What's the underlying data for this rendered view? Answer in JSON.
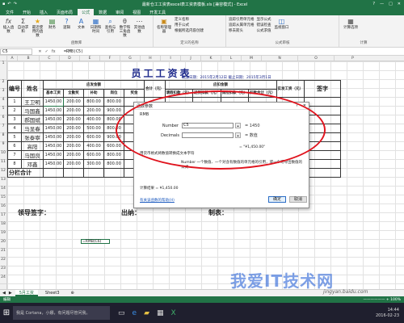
{
  "window": {
    "title": "最新仓工工资表excel表工资表模板.xls [兼容模式] - Excel",
    "qa_icons": [
      "save-icon",
      "undo-icon",
      "redo-icon"
    ],
    "controls": [
      "?",
      "—",
      "□",
      "✕"
    ]
  },
  "ribbon_tabs": [
    "文件",
    "开始",
    "插入",
    "页面布局",
    "公式",
    "数据",
    "审阅",
    "视图",
    "开发工具"
  ],
  "active_tab": "公式",
  "ribbon": {
    "fx_group": [
      {
        "label": "插入函数",
        "icon": "fx-icon"
      },
      {
        "label": "自动求和",
        "icon": "sum-icon"
      },
      {
        "label": "最近使用的函数",
        "icon": "star-icon"
      },
      {
        "label": "财务",
        "icon": "money-icon"
      },
      {
        "label": "逻辑",
        "icon": "question-icon"
      },
      {
        "label": "文本",
        "icon": "text-icon"
      },
      {
        "label": "日期和时间",
        "icon": "calendar-icon"
      },
      {
        "label": "查找与引用",
        "icon": "lookup-icon"
      },
      {
        "label": "数学和三角函数",
        "icon": "theta-icon"
      },
      {
        "label": "其他函数",
        "icon": "more-icon"
      }
    ],
    "fx_group_label": "函数库",
    "names_manager": "名称管理器",
    "names_items": [
      "定义名称",
      "用于公式",
      "根据所选内容创建"
    ],
    "names_label": "定义的名称",
    "audit_items": [
      "追踪引用单元格",
      "追踪从属单元格",
      "移去箭头"
    ],
    "audit_items2": [
      "显示公式",
      "错误检查",
      "公式求值"
    ],
    "watch": "监视窗口",
    "audit_label": "公式审核",
    "calc_options": "计算选项",
    "calc_label": "计算"
  },
  "formula_bar": {
    "name_box": "C5",
    "fx_icons": [
      "✕",
      "✓",
      "fx"
    ],
    "formula": "=RMB(C5)"
  },
  "columns": [
    "A",
    "B",
    "C",
    "D",
    "E",
    "F",
    "G",
    "H",
    "I",
    "J",
    "K",
    "L",
    "M",
    "N",
    "O",
    "P"
  ],
  "rows": [
    "1",
    "2",
    "3",
    "4",
    "5",
    "6",
    "7",
    "8",
    "9",
    "10",
    "11",
    "12",
    "13",
    "14",
    "15",
    "16",
    "17",
    "18",
    "19",
    "20",
    "21",
    "22",
    "23",
    "24",
    "25",
    "26"
  ],
  "sheet": {
    "title": "员工工资表",
    "dateline": "发放日期：2015年2月12日  截止日期：2015年3月1日",
    "headers": {
      "num": "编号",
      "name": "姓名",
      "group_pay": "应发金额",
      "group_deduct": "应扣金额",
      "base": "基本工资",
      "allowance": "全勤奖",
      "bonus": "补助",
      "misc": "岗位",
      "award": "奖金",
      "total": "合计（元）",
      "ded1": "请假扣款（元）",
      "ded2": "迟到扣款（元）",
      "ded3": "保险扣款（元）",
      "ded_total": "扣款合计（元）",
      "actual": "实发工资（元）",
      "sign": "签字"
    },
    "rows": [
      {
        "id": "1",
        "name": "王卫明",
        "base": "1450.00",
        "c": "200.00",
        "d": "800.00",
        "e": "800.00"
      },
      {
        "id": "2",
        "name": "马国鑫",
        "base": "1450.00",
        "c": "200.00",
        "d": "200.00",
        "e": "900.00"
      },
      {
        "id": "3",
        "name": "郝国斌",
        "base": "1450.00",
        "c": "200.00",
        "d": "400.00",
        "e": "800.00"
      },
      {
        "id": "4",
        "name": "马显春",
        "base": "1450.00",
        "c": "200.00",
        "d": "500.00",
        "e": "800.00"
      },
      {
        "id": "5",
        "name": "张泰寧",
        "base": "1450.00",
        "c": "200.00",
        "d": "600.00",
        "e": "900.00"
      },
      {
        "id": "6",
        "name": "高阳",
        "base": "1450.00",
        "c": "200.00",
        "d": "400.00",
        "e": "600.00"
      },
      {
        "id": "7",
        "name": "马国良",
        "base": "1450.00",
        "c": "200.00",
        "d": "600.00",
        "e": "800.00"
      },
      {
        "id": "8",
        "name": "邓鑫",
        "base": "1450.00",
        "c": "200.00",
        "d": "300.00",
        "e": "800.00"
      }
    ],
    "total_label": "分栏合计",
    "sig_leader": "领导签字：",
    "sig_cashier": "出纳：",
    "sig_maker": "制表：",
    "cell_c22": "=RMB(C6)"
  },
  "dialog": {
    "title": "函数参数",
    "controls": [
      "?",
      "✕"
    ],
    "fn_name": "RMB",
    "args": [
      {
        "label": "Number",
        "value": "C5",
        "result": "= 1450"
      },
      {
        "label": "Decimals",
        "value": "",
        "result": "= 数值"
      }
    ],
    "result_preview": "= \"¥1,450.00\"",
    "desc1": "用货币格式将数值转换成文本字符",
    "desc2": "Number  一个数值、一个对含有数值的单元格的引用，或一个可导出数值的公式",
    "calc_result": "计算结果 = ¥1,450.00",
    "help_link": "有关该函数的帮助(H)",
    "ok": "确定",
    "cancel": "取消"
  },
  "sheet_tabs": [
    "5月工资",
    "Sheet3",
    "⊕"
  ],
  "active_sheet": "5月工资",
  "statusbar": {
    "left": "编辑",
    "right": "—————— + 100%"
  },
  "taskbar": {
    "search": "我是 Cortana，小娜，有问题尽管问我。",
    "time": "14:44",
    "date": "2016-02-23"
  },
  "watermark": {
    "main": "我爱IT技术网",
    "sub": "jingyan.baidu.com"
  },
  "accent": "#217346",
  "annotation_color": "#e0141e"
}
